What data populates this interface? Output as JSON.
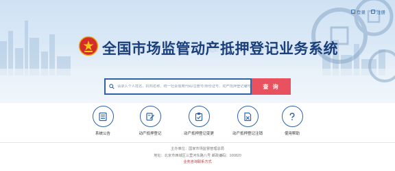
{
  "header": {
    "title": "全国市场监管动产抵押登记业务系统",
    "login_label": "登录",
    "register_label": "注册"
  },
  "search": {
    "placeholder": "请录入个人姓名、机构名称、统一社会信用代码/注册号/身份证号、动产抵押登记编号",
    "value": "",
    "button_label": "查 询"
  },
  "services": [
    {
      "label": "系统公告",
      "icon": "notice-list-icon"
    },
    {
      "label": "动产抵押登记",
      "icon": "registration-icon"
    },
    {
      "label": "动产抵押登记变更",
      "icon": "change-clipboard-icon"
    },
    {
      "label": "动产抵押登记注销",
      "icon": "cancel-doc-icon"
    },
    {
      "label": "使用帮助",
      "icon": "help-question-icon"
    }
  ],
  "footer": {
    "sponsor": "主办单位：国家市场监督管理总局",
    "address": "地址：北京市西城区三里河东路八号    邮政编码：100820",
    "contact_link": "业务咨询联系方式"
  },
  "colors": {
    "title": "#1a3f7a",
    "accent_blue": "#2b62a8",
    "search_button": "#e8525e",
    "footer_link": "#d2323a"
  }
}
